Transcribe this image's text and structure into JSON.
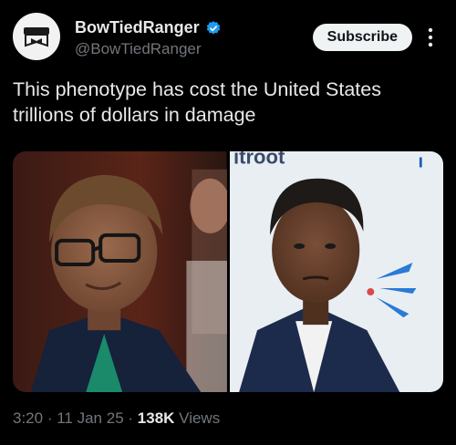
{
  "author": {
    "display_name": "BowTiedRanger",
    "handle": "@BowTiedRanger",
    "verified": true,
    "avatar_icon": "bowtie-ranger-logo-icon"
  },
  "actions": {
    "subscribe_label": "Subscribe",
    "more_icon": "more-vertical-icon"
  },
  "tweet": {
    "text_line1": "This phenotype has cost the United States",
    "text_line2": "trillions of dollars in damage"
  },
  "media": {
    "left_photo_label": "",
    "right_photo_sign_text": "ıtroot"
  },
  "meta": {
    "time": "3:20",
    "sep1": "·",
    "date": "11 Jan 25",
    "sep2": "·",
    "views_count": "138K",
    "views_label": "Views"
  },
  "colors": {
    "background": "#000000",
    "text_primary": "#e7e9ea",
    "text_secondary": "#71767b",
    "verified_blue": "#1d9bf0",
    "subscribe_bg": "#eff3f4"
  }
}
